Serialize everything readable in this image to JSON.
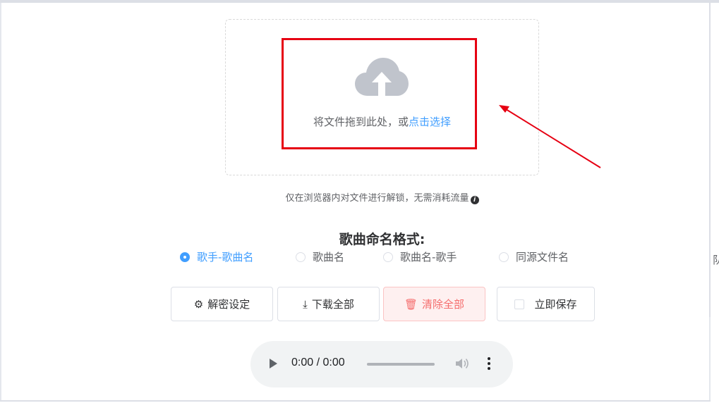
{
  "upload": {
    "prompt": "将文件拖到此处，或",
    "link": "点击选择",
    "icon": "cloud-upload-icon"
  },
  "tip": {
    "text": "仅在浏览器内对文件进行解锁，无需消耗流量",
    "icon": "info-icon"
  },
  "naming": {
    "title": "歌曲命名格式:",
    "options": [
      "歌手-歌曲名",
      "歌曲名",
      "歌曲名-歌手",
      "同源文件名"
    ],
    "selected": "歌手-歌曲名"
  },
  "buttons": {
    "settings": "解密设定",
    "download_all": "下载全部",
    "clear_all": "清除全部",
    "save_now": "立即保存"
  },
  "player": {
    "time": "0:00 / 0:00",
    "progress": 0
  },
  "edge_glyph": "队",
  "colors": {
    "accent": "#409eff",
    "danger": "#f56c6c",
    "annotation": "#e60012"
  }
}
